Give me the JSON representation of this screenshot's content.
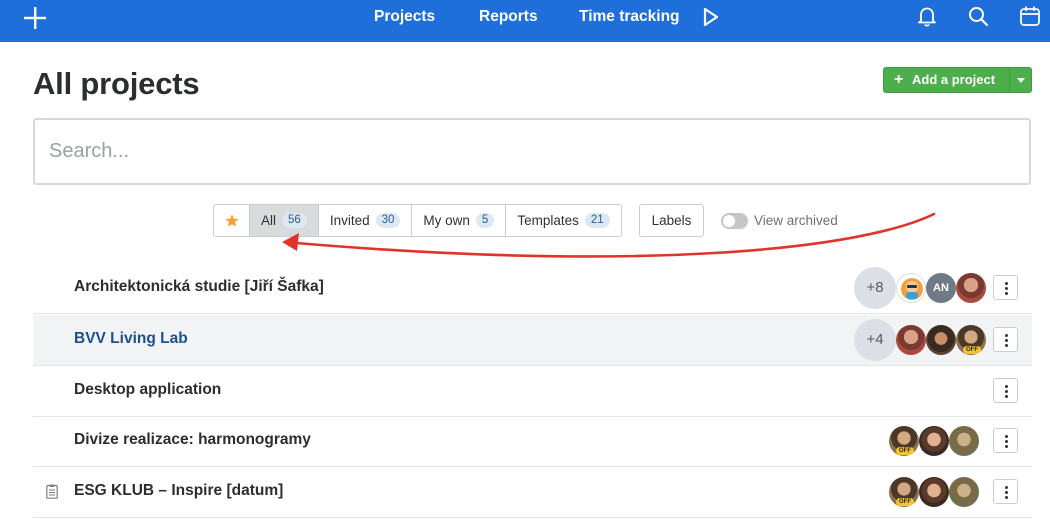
{
  "nav": {
    "links": [
      "Projects",
      "Reports",
      "Time tracking"
    ]
  },
  "header": {
    "title": "All projects",
    "add_button_label": "Add a project"
  },
  "search": {
    "placeholder": "Search..."
  },
  "filters": {
    "tabs": [
      {
        "label": "All",
        "count": "56"
      },
      {
        "label": "Invited",
        "count": "30"
      },
      {
        "label": "My own",
        "count": "5"
      },
      {
        "label": "Templates",
        "count": "21"
      }
    ],
    "labels_button": "Labels",
    "view_archived_label": "View archived"
  },
  "projects": [
    {
      "name": "Architektonická studie [Jiří Šafka]",
      "extra_members": "+8",
      "avatar_initials": "AN"
    },
    {
      "name": "BVV Living Lab",
      "extra_members": "+4"
    },
    {
      "name": "Desktop application"
    },
    {
      "name": "Divize realizace: harmonogramy"
    },
    {
      "name": "ESG KLUB – Inspire [datum]"
    }
  ],
  "status_labels": {
    "off": "OFF"
  },
  "colors": {
    "topbar": "#1e6fd9",
    "add_button": "#4cae4c",
    "annotation_arrow": "#e0342b",
    "star": "#f0a33a"
  }
}
